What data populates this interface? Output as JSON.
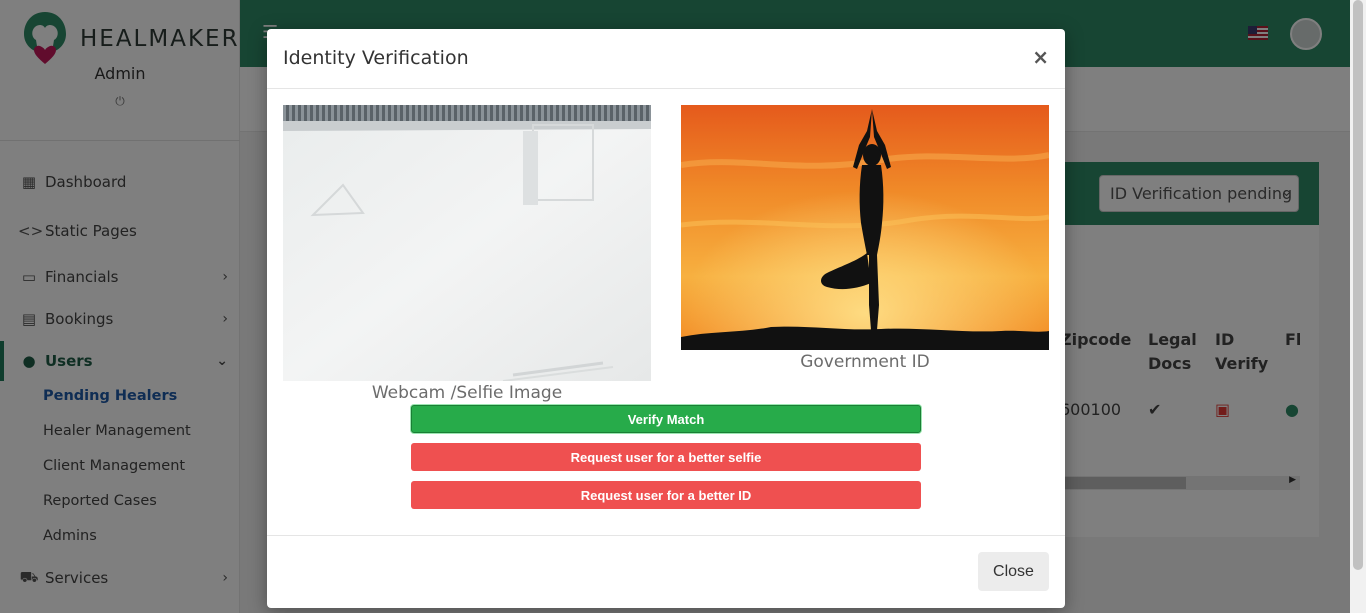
{
  "sidebar": {
    "brand": "HEALMAKER",
    "role": "Admin",
    "power_glyph": "⏻",
    "items": [
      {
        "label": "Dashboard",
        "icon": "dashboard-icon"
      },
      {
        "label": "Static Pages",
        "icon": "code-icon"
      },
      {
        "label": "Financials",
        "icon": "money-icon"
      },
      {
        "label": "Bookings",
        "icon": "calendar-icon"
      },
      {
        "label": "Users",
        "icon": "users-icon"
      },
      {
        "label": "Services",
        "icon": "cart-icon"
      }
    ],
    "sub_items": [
      "Pending Healers",
      "Healer Management",
      "Client Management",
      "Reported Cases",
      "Admins"
    ]
  },
  "filter": {
    "selected": "ID Verification pending"
  },
  "table": {
    "headers": [
      "Zipcode",
      "Legal Docs",
      "ID Verify",
      "Fl"
    ],
    "row": {
      "zipcode": "600100"
    }
  },
  "modal": {
    "title": "Identity Verification",
    "close_x": "×",
    "selfie_caption": "Webcam /Selfie Image",
    "govid_caption": "Government ID",
    "verify_label": "Verify Match",
    "request_selfie_label": "Request user for a better selfie",
    "request_id_label": "Request user for a better ID",
    "close_label": "Close"
  },
  "colors": {
    "primary_green": "#2e8b66",
    "verify_green": "#27ab4a",
    "request_red": "#ef5050"
  }
}
